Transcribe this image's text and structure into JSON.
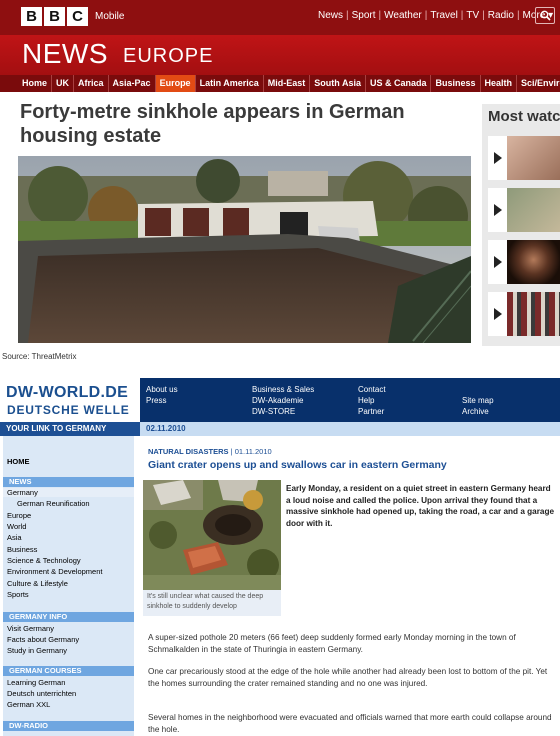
{
  "bbc": {
    "logo_letters": [
      "B",
      "B",
      "C"
    ],
    "mobile_label": "Mobile",
    "top_nav": [
      "News",
      "Sport",
      "Weather",
      "Travel",
      "TV",
      "Radio",
      "More ▾"
    ],
    "news_label": "NEWS",
    "section_label": "EUROPE",
    "section_nav": [
      "Home",
      "UK",
      "Africa",
      "Asia-Pac",
      "Europe",
      "Latin America",
      "Mid-East",
      "South Asia",
      "US & Canada",
      "Business",
      "Health",
      "Sci/Environment"
    ],
    "active_section": "Europe",
    "headline": "Forty-metre sinkhole appears in German housing estate",
    "most_watched_title": "Most watc",
    "most_watched_count": 4
  },
  "source_text": "Source: ThreatMetrix",
  "dw": {
    "logo_line1": "DW-WORLD.DE",
    "logo_line2": "DEUTSCHE WELLE",
    "top_links": {
      "col1": [
        "About us",
        "Press"
      ],
      "col2": [
        "Business & Sales",
        "DW-Akademie",
        "DW-STORE"
      ],
      "col3": [
        "Contact",
        "Help",
        "Partner"
      ],
      "col4": [
        "Site map",
        "Archive"
      ]
    },
    "your_link": "YOUR LINK TO GERMANY",
    "date": "02.11.2010",
    "sidebar": {
      "home": "HOME",
      "news_header": "NEWS",
      "news_items": [
        "Germany",
        "German Reunification",
        "Europe",
        "World",
        "Asia",
        "Business",
        "Science & Technology",
        "Environment & Development",
        "Culture & Lifestyle",
        "Sports"
      ],
      "germany_info_header": "GERMANY INFO",
      "germany_info_items": [
        "Visit Germany",
        "Facts about Germany",
        "Study in Germany"
      ],
      "courses_header": "GERMAN COURSES",
      "courses_items": [
        "Learning German",
        "Deutsch unterrichten",
        "German XXL"
      ],
      "radio_header": "DW-RADIO"
    },
    "article": {
      "category": "NATURAL DISASTERS",
      "date": "01.11.2010",
      "title": "Giant crater opens up and swallows car in eastern Germany",
      "photo_caption": "It's still unclear what caused the deep sinkhole to suddenly develop",
      "lead": "Early Monday, a resident on a quiet street in eastern Germany heard a loud noise and called the police. Upon arrival they found that a massive sinkhole had opened up, taking the road, a car and a garage door with it.",
      "paragraphs": [
        "A super-sized pothole 20 meters (66 feet) deep suddenly formed early Monday morning in the town of Schmalkalden in the state of Thuringia in eastern Germany.",
        "One car precariously stood at the edge of the hole while another had already been lost to bottom of the pit. Yet the homes surrounding the crater remained standing and no one was injured.",
        "Several homes in the neighborhood were evacuated and officials warned that more earth could collapse around the hole."
      ]
    }
  },
  "colors": {
    "bbc_dark_red": "#8e0f10",
    "bbc_red": "#c01416",
    "bbc_nav_active": "#e24b14",
    "dw_navy": "#08306b",
    "dw_blue": "#1d4f94",
    "dw_section": "#6fa6e0"
  }
}
